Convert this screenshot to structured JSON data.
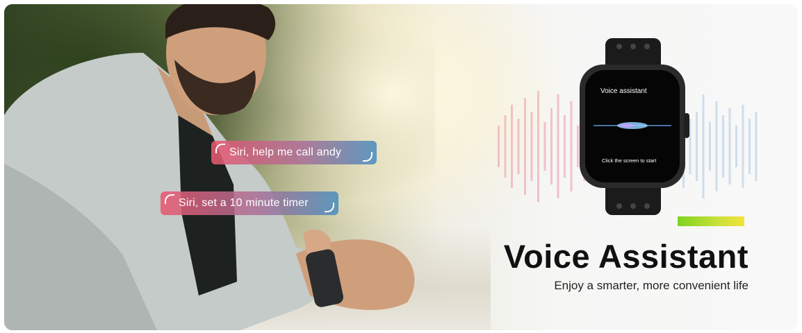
{
  "bubbles": {
    "first": "Siri, help me call andy",
    "second": "Siri, set a 10 minute timer"
  },
  "watch_screen": {
    "title": "Voice assistant",
    "hint": "Click the screen to start"
  },
  "headline": "Voice Assistant",
  "subheadline": "Enjoy a smarter, more convenient life",
  "colors": {
    "accent_green": "#7ed321",
    "accent_yellow": "#f2e33b",
    "bubble_pink": "#e85870",
    "bubble_blue": "#468cbe",
    "headline_text": "#111111"
  }
}
